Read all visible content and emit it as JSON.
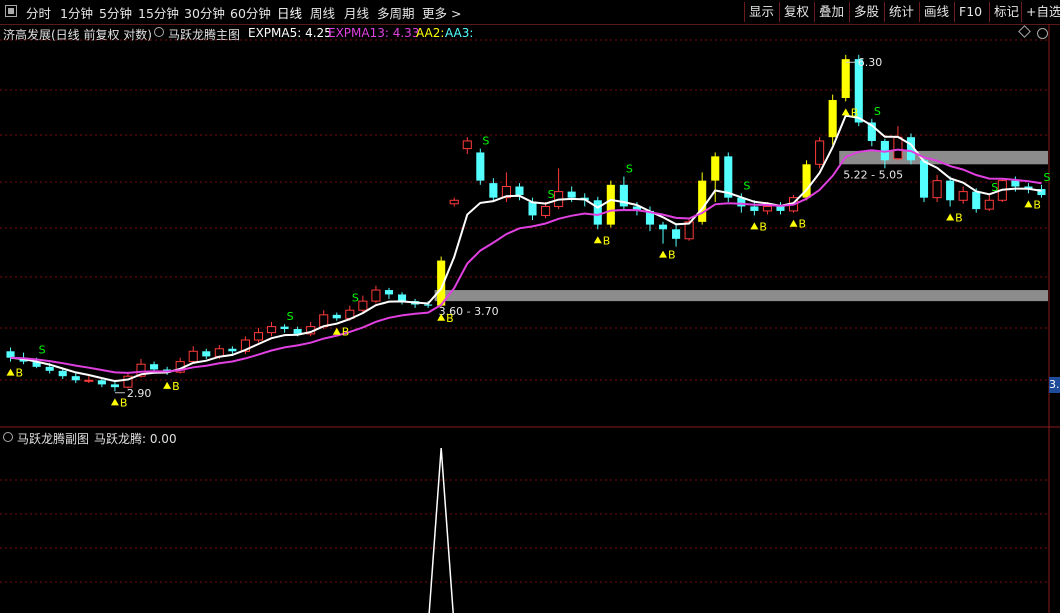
{
  "toolbar": {
    "periods": [
      "分时",
      "1分钟",
      "5分钟",
      "15分钟",
      "30分钟",
      "60分钟",
      "日线",
      "周线",
      "月线",
      "多周期",
      "更多 >"
    ],
    "active_period": "日线",
    "right_buttons": [
      "显示",
      "复权",
      "叠加",
      "多股",
      "统计",
      "画线",
      "F10",
      "标记",
      "+自选"
    ]
  },
  "main_info": {
    "stock": "济高发展(日线 前复权 对数)",
    "indicator": "马跃龙腾主图",
    "expma5": "EXPMA5: 4.25",
    "expma13": "EXPMA13: 4.33",
    "aa2": "AA2:",
    "aa3": "AA3:"
  },
  "price_label": "3.",
  "sub_info": {
    "title": "马跃龙腾副图",
    "value": "马跃龙腾: 0.00"
  },
  "colors": {
    "up": "#ff3b3b",
    "down": "#54ffff",
    "signal": "#ffff00",
    "expma5": "#ffffff",
    "expma13": "#e040e0",
    "sell": "#00ff00",
    "zone": "#8c8c8c",
    "grid": "#7a0e0e"
  },
  "chart_data": [
    {
      "type": "candlestick",
      "scale": "log",
      "ylim": [
        2.65,
        6.8
      ],
      "candles": [
        [
          3.18,
          3.13,
          3.21,
          3.1
        ],
        [
          3.13,
          3.1,
          3.17,
          3.08
        ],
        [
          3.1,
          3.06,
          3.13,
          3.05
        ],
        [
          3.06,
          3.03,
          3.09,
          3.01
        ],
        [
          3.03,
          2.99,
          3.05,
          2.97
        ],
        [
          2.99,
          2.96,
          3.02,
          2.94
        ],
        [
          2.96,
          2.96,
          2.99,
          2.94
        ],
        [
          2.96,
          2.93,
          2.98,
          2.91
        ],
        [
          2.93,
          2.91,
          2.95,
          2.88
        ],
        [
          2.91,
          2.99,
          3.02,
          2.9
        ],
        [
          2.99,
          3.08,
          3.12,
          2.98
        ],
        [
          3.08,
          3.04,
          3.1,
          3.02
        ],
        [
          3.04,
          3.02,
          3.06,
          3.0
        ],
        [
          3.02,
          3.1,
          3.13,
          3.01
        ],
        [
          3.1,
          3.18,
          3.22,
          3.09
        ],
        [
          3.18,
          3.14,
          3.2,
          3.12
        ],
        [
          3.14,
          3.2,
          3.23,
          3.12
        ],
        [
          3.2,
          3.18,
          3.22,
          3.15
        ],
        [
          3.18,
          3.27,
          3.3,
          3.16
        ],
        [
          3.27,
          3.33,
          3.37,
          3.25
        ],
        [
          3.33,
          3.38,
          3.42,
          3.3
        ],
        [
          3.38,
          3.36,
          3.4,
          3.33
        ],
        [
          3.36,
          3.32,
          3.38,
          3.3
        ],
        [
          3.32,
          3.38,
          3.42,
          3.3
        ],
        [
          3.38,
          3.48,
          3.52,
          3.36
        ],
        [
          3.48,
          3.45,
          3.5,
          3.43
        ],
        [
          3.45,
          3.52,
          3.56,
          3.43
        ],
        [
          3.52,
          3.6,
          3.65,
          3.5
        ],
        [
          3.6,
          3.7,
          3.74,
          3.58
        ],
        [
          3.7,
          3.66,
          3.72,
          3.62
        ],
        [
          3.66,
          3.6,
          3.68,
          3.57
        ],
        [
          3.6,
          3.57,
          3.62,
          3.54
        ],
        [
          3.57,
          3.56,
          3.6,
          3.54
        ],
        [
          3.56,
          3.98,
          4.02,
          3.55
        ],
        [
          4.58,
          4.62,
          4.65,
          4.55
        ],
        [
          5.25,
          5.35,
          5.4,
          5.18
        ],
        [
          5.2,
          4.85,
          5.25,
          4.8
        ],
        [
          4.82,
          4.65,
          4.88,
          4.6
        ],
        [
          4.65,
          4.78,
          4.95,
          4.6
        ],
        [
          4.78,
          4.68,
          4.82,
          4.62
        ],
        [
          4.6,
          4.45,
          4.65,
          4.4
        ],
        [
          4.45,
          4.55,
          4.6,
          4.42
        ],
        [
          4.55,
          4.72,
          5.0,
          4.52
        ],
        [
          4.72,
          4.65,
          4.78,
          4.6
        ],
        [
          4.65,
          4.62,
          4.7,
          4.55
        ],
        [
          4.62,
          4.35,
          4.66,
          4.3
        ],
        [
          4.35,
          4.8,
          4.85,
          4.32
        ],
        [
          4.8,
          4.55,
          4.9,
          4.5
        ],
        [
          4.55,
          4.5,
          4.6,
          4.45
        ],
        [
          4.5,
          4.35,
          4.55,
          4.28
        ],
        [
          4.35,
          4.3,
          4.38,
          4.15
        ],
        [
          4.3,
          4.2,
          4.35,
          4.12
        ],
        [
          4.2,
          4.38,
          4.42,
          4.18
        ],
        [
          4.38,
          4.85,
          4.95,
          4.35
        ],
        [
          4.85,
          5.15,
          5.2,
          4.6
        ],
        [
          5.15,
          4.65,
          5.2,
          4.6
        ],
        [
          4.65,
          4.55,
          4.7,
          4.48
        ],
        [
          4.55,
          4.5,
          4.62,
          4.45
        ],
        [
          4.5,
          4.55,
          4.6,
          4.46
        ],
        [
          4.55,
          4.5,
          4.6,
          4.46
        ],
        [
          4.5,
          4.65,
          4.68,
          4.48
        ],
        [
          4.65,
          5.05,
          5.1,
          4.62
        ],
        [
          5.05,
          5.35,
          5.4,
          5.0
        ],
        [
          5.4,
          5.92,
          6.0,
          5.3
        ],
        [
          5.95,
          6.55,
          6.62,
          5.9
        ],
        [
          6.55,
          5.6,
          6.62,
          5.55
        ],
        [
          5.6,
          5.35,
          5.65,
          5.28
        ],
        [
          5.35,
          5.1,
          5.38,
          5.0
        ],
        [
          5.12,
          5.4,
          5.55,
          5.1
        ],
        [
          5.4,
          5.1,
          5.45,
          5.05
        ],
        [
          5.1,
          4.65,
          5.15,
          4.6
        ],
        [
          4.65,
          4.85,
          4.92,
          4.6
        ],
        [
          4.85,
          4.62,
          4.9,
          4.55
        ],
        [
          4.62,
          4.72,
          4.78,
          4.58
        ],
        [
          4.72,
          4.52,
          4.76,
          4.48
        ],
        [
          4.52,
          4.62,
          4.68,
          4.5
        ],
        [
          4.62,
          4.85,
          4.88,
          4.6
        ],
        [
          4.85,
          4.78,
          4.9,
          4.72
        ],
        [
          4.78,
          4.75,
          4.82,
          4.7
        ],
        [
          4.75,
          4.68,
          4.8,
          4.65
        ]
      ],
      "zones": [
        {
          "top": 3.7,
          "bottom": 3.6,
          "label": "3.60 - 3.70",
          "start_index": 33
        },
        {
          "top": 5.22,
          "bottom": 5.05,
          "label": "5.22 - 5.05",
          "start_index": 64
        }
      ],
      "annotations": [
        {
          "text": "6.30",
          "index": 64,
          "value": 6.5
        },
        {
          "text": "2.90",
          "index": 8,
          "value": 2.87
        }
      ],
      "buy_signals": [
        0,
        8,
        12,
        25,
        33,
        45,
        50,
        57,
        60,
        64,
        72,
        78
      ],
      "sell_signals": [
        2,
        21,
        26,
        36,
        41,
        47,
        56,
        66,
        75,
        79
      ]
    },
    {
      "type": "line",
      "name": "马跃龙腾",
      "ylim": [
        0,
        1
      ],
      "values": [
        0,
        0,
        0,
        0,
        0,
        0,
        0,
        0,
        0,
        0,
        0,
        0,
        0,
        0,
        0,
        0,
        0,
        0,
        0,
        0,
        0,
        0,
        0,
        0,
        0,
        0,
        0,
        0,
        0,
        0,
        0,
        0,
        0,
        1,
        0,
        0,
        0,
        0,
        0,
        0,
        0,
        0,
        0,
        0,
        0,
        0,
        0,
        0,
        0,
        0,
        0,
        0,
        0,
        0,
        0,
        0,
        0,
        0,
        0,
        0,
        0,
        0,
        0,
        0,
        0,
        0,
        0,
        0,
        0,
        0,
        0,
        0,
        0,
        0,
        0,
        0,
        0,
        0,
        0,
        0
      ]
    }
  ]
}
